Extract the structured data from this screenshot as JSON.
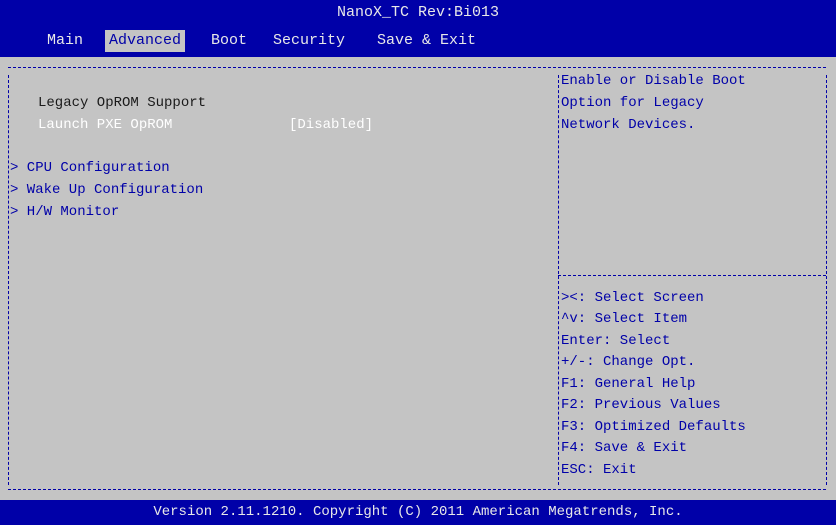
{
  "header": {
    "title": "NanoX_TC Rev:Bi013",
    "tabs": [
      {
        "label": "Main"
      },
      {
        "label": "Advanced"
      },
      {
        "label": "Boot"
      },
      {
        "label": "Security"
      },
      {
        "label": "Save & Exit"
      }
    ],
    "active_tab": "Advanced"
  },
  "main": {
    "heading": "Legacy OpROM Support",
    "settings": [
      {
        "label": "Launch PXE OpROM",
        "value": "[Disabled]"
      }
    ],
    "submenus": [
      {
        "label": "> CPU Configuration"
      },
      {
        "label": "> Wake Up Configuration"
      },
      {
        "label": "> H/W Monitor"
      }
    ]
  },
  "help": {
    "description": [
      "Enable or Disable Boot",
      "Option for Legacy",
      "Network Devices."
    ],
    "keys": [
      "><: Select Screen",
      "^v: Select Item",
      "Enter: Select",
      "+/-: Change Opt.",
      "F1: General Help",
      "F2: Previous Values",
      "F3: Optimized Defaults",
      "F4: Save & Exit",
      "ESC: Exit"
    ]
  },
  "footer": {
    "version": "Version 2.11.1210. Copyright (C) 2011 American Megatrends, Inc."
  },
  "colors": {
    "bar_blue": "#0000a8",
    "panel_gray": "#c4c4c4",
    "text_white": "#ffffff",
    "text_dark": "#1a1a1a"
  }
}
